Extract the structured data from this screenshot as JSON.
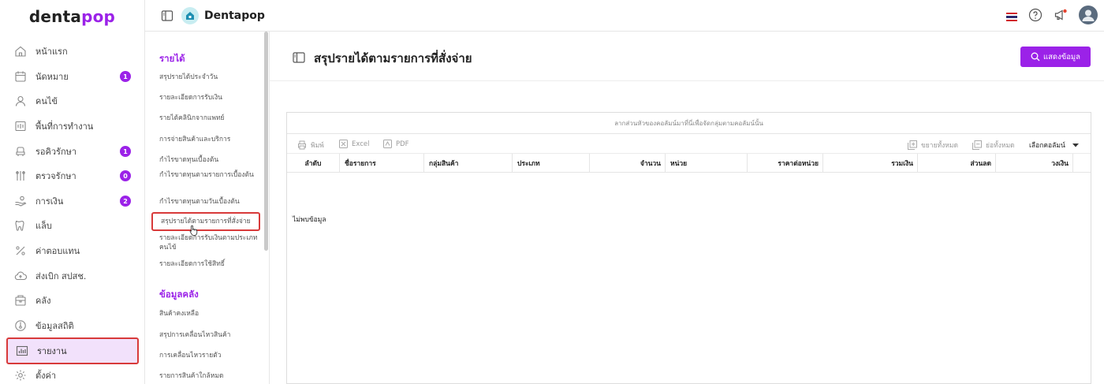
{
  "app": {
    "logo_main": "denta",
    "logo_accent": "pop",
    "brand_name": "Dentapop",
    "accent_color": "#9b22e8"
  },
  "nav": {
    "items": [
      {
        "label": "หน้าแรก",
        "icon": "home-icon",
        "badge": ""
      },
      {
        "label": "นัดหมาย",
        "icon": "calendar-icon",
        "badge": "1"
      },
      {
        "label": "คนไข้",
        "icon": "user-icon",
        "badge": ""
      },
      {
        "label": "พื้นที่การทำงาน",
        "icon": "workspace-icon",
        "badge": ""
      },
      {
        "label": "รอคิวรักษา",
        "icon": "dental-chair-icon",
        "badge": "1"
      },
      {
        "label": "ตรวจรักษา",
        "icon": "dental-tools-icon",
        "badge": "0"
      },
      {
        "label": "การเงิน",
        "icon": "payment-icon",
        "badge": "2"
      },
      {
        "label": "แล็บ",
        "icon": "tooth-icon",
        "badge": ""
      },
      {
        "label": "ค่าตอบแทน",
        "icon": "percent-icon",
        "badge": ""
      },
      {
        "label": "ส่งเบิก สปสช.",
        "icon": "cloud-upload-icon",
        "badge": ""
      },
      {
        "label": "คลัง",
        "icon": "inventory-icon",
        "badge": ""
      },
      {
        "label": "ข้อมูลสถิติ",
        "icon": "statistics-icon",
        "badge": ""
      },
      {
        "label": "รายงาน",
        "icon": "report-chart-icon",
        "badge": ""
      },
      {
        "label": "ตั้งค่า",
        "icon": "settings-icon",
        "badge": ""
      }
    ],
    "active_index": 12
  },
  "submenu": {
    "income_heading": "รายได้",
    "income_items": [
      "สรุปรายได้ประจำวัน",
      "รายละเอียดการรับเงิน",
      "รายได้คลินิกจากแพทย์",
      "การจ่ายสินค้าและบริการ",
      "กำไรขาดทุนเบื้องต้น",
      "กำไรขาดทุนตามรายการเบื้องต้น",
      "กำไรขาดทุนตามวันเบื้องต้น",
      "สรุปรายได้ตามรายการที่สั่งจ่าย",
      "รายละเอียดการรับเงินตามประเภทคนไข้",
      "รายละเอียดการใช้สิทธิ์"
    ],
    "stock_heading": "ข้อมูลคลัง",
    "stock_items": [
      "สินค้าคงเหลือ",
      "สรุปการเคลื่อนไหวสินค้า",
      "การเคลื่อนไหวรายตัว",
      "รายการสินค้าใกล้หมด"
    ]
  },
  "page": {
    "title": "สรุปรายได้ตามรายการที่สั่งจ่าย",
    "show_button": "แสดงข้อมูล"
  },
  "grid": {
    "group_panel_text": "ลากส่วนหัวของคอลัมน์มาที่นี่เพื่อจัดกลุ่มตามคอลัมน์นั้น",
    "toolbar": {
      "print": "พิมพ์",
      "excel": "Excel",
      "pdf": "PDF",
      "expand_all": "ขยายทั้งหมด",
      "collapse_all": "ย่อทั้งหมด",
      "choose_columns": "เลือกคอลัมน์"
    },
    "columns": [
      "ลำดับ",
      "ชื่อรายการ",
      "กลุ่มสินค้า",
      "ประเภท",
      "จำนวน",
      "หน่วย",
      "ราคาต่อหน่วย",
      "รวมเงิน",
      "ส่วนลด",
      "วงเงิน"
    ],
    "no_data": "ไม่พบข้อมูล"
  }
}
